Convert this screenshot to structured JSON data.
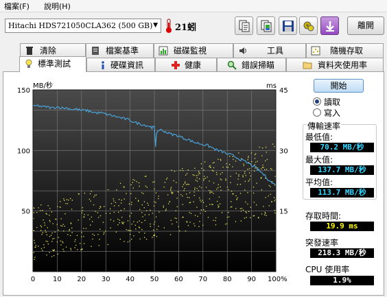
{
  "menu": {
    "items": [
      "檔案(F)",
      "說明(H)"
    ]
  },
  "toolbar": {
    "drive": "Hitachi HDS721050CLA362 (500 GB)",
    "temperature": "21蚓",
    "buttons": [
      "copy-text-icon",
      "copy-screenshot-icon",
      "save-icon",
      "options-icon",
      "download-icon"
    ],
    "exit_label": "離開"
  },
  "tabs_top": [
    {
      "label": "清除",
      "icon": "trash-icon"
    },
    {
      "label": "檔案基準",
      "icon": "file-benchmark-icon"
    },
    {
      "label": "磁碟監視",
      "icon": "disk-monitor-icon"
    },
    {
      "label": "工具",
      "icon": "speaker-icon"
    },
    {
      "label": "隨機存取",
      "icon": "random-access-icon"
    }
  ],
  "tabs_bottom": [
    {
      "label": "標準測試",
      "icon": "lightbulb-icon",
      "active": true
    },
    {
      "label": "硬碟資訊",
      "icon": "info-icon"
    },
    {
      "label": "健康",
      "icon": "health-cross-icon"
    },
    {
      "label": "錯誤掃瞄",
      "icon": "magnifier-icon"
    },
    {
      "label": "資料夾使用率",
      "icon": "folder-icon"
    }
  ],
  "controls": {
    "start_label": "開始",
    "radio_read": "讀取",
    "radio_write": "寫入",
    "selected": "read"
  },
  "stats": {
    "transfer_rate_label": "傳輸速率",
    "min_label": "最低值:",
    "min_value": "70.2 MB/秒",
    "max_label": "最大值:",
    "max_value": "137.7 MB/秒",
    "avg_label": "平均值:",
    "avg_value": "113.7 MB/秒",
    "access_label": "存取時間:",
    "access_value": "19.9 ms",
    "burst_label": "突發速率",
    "burst_value": "218.3 MB/秒",
    "cpu_label": "CPU 使用率",
    "cpu_value": "1.9%"
  },
  "colors": {
    "transfer_line": "#4aa3d8",
    "access_dots": "#e8e85a",
    "grid": "#808080",
    "plot_bg_top": "#4a4a4a",
    "plot_bg_bottom": "#000000"
  },
  "chart_data": {
    "type": "line",
    "left_unit": "MB/秒",
    "right_unit": "ms",
    "ylim_left": [
      0,
      150
    ],
    "ylim_right": [
      0,
      45
    ],
    "xlim": [
      0,
      100
    ],
    "left_ticks": [
      "150",
      "100",
      "50"
    ],
    "right_ticks": [
      "45",
      "30",
      "15"
    ],
    "x_ticks": [
      "0",
      "10",
      "20",
      "30",
      "40",
      "50",
      "60",
      "70",
      "80",
      "90",
      "100%"
    ],
    "grid": true,
    "series": [
      {
        "x": [
          0,
          2,
          4,
          6,
          8,
          10,
          12,
          14,
          16,
          18,
          20,
          22,
          24,
          26,
          28,
          30,
          32,
          34,
          36,
          38,
          40,
          42,
          44,
          46,
          48,
          49,
          50,
          50.5,
          51,
          52,
          54,
          56,
          58,
          60,
          62,
          64,
          66,
          68,
          70,
          72,
          74,
          76,
          78,
          80,
          82,
          84,
          86,
          88,
          90,
          92,
          94,
          96,
          98,
          100
        ],
        "y": [
          136,
          137,
          136,
          136,
          135,
          136,
          135,
          135,
          134,
          134,
          133,
          133,
          132,
          131,
          131,
          130,
          129,
          128,
          127,
          126,
          125,
          123,
          122,
          121,
          120,
          119,
          119,
          104,
          115,
          117,
          116,
          114,
          113,
          112,
          110,
          109,
          107,
          106,
          105,
          104,
          102,
          100,
          99,
          97,
          96,
          94,
          92,
          90,
          88,
          85,
          82,
          78,
          74,
          71
        ]
      }
    ],
    "scatter": {
      "x_range": [
        0,
        100
      ],
      "ms_range_start": [
        3,
        17
      ],
      "ms_range_end": [
        14,
        32
      ],
      "count": 600
    }
  }
}
